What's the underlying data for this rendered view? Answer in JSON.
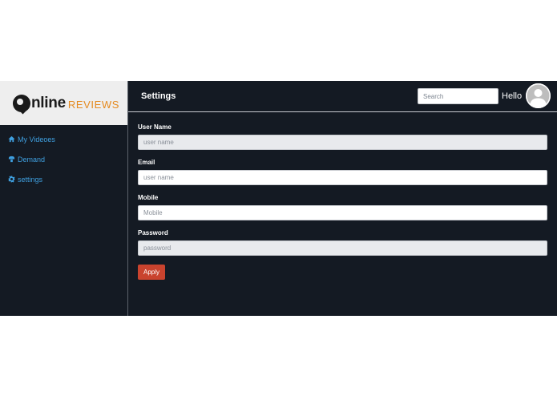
{
  "brand": {
    "logo_main": "nline",
    "logo_sub": "REVIEWS"
  },
  "sidebar": {
    "items": [
      {
        "label": "My Videoes",
        "icon": "home-icon"
      },
      {
        "label": "Demand",
        "icon": "demand-icon"
      },
      {
        "label": "settings",
        "icon": "gear-icon"
      }
    ]
  },
  "header": {
    "title": "Settings",
    "search_placeholder": "Search",
    "greeting": "Hello",
    "avatar_icon": "user-avatar-icon"
  },
  "form": {
    "fields": [
      {
        "label": "User Name",
        "placeholder": "user name",
        "value": "",
        "state": "disabled"
      },
      {
        "label": "Email",
        "placeholder": "user name",
        "value": "",
        "state": "enabled"
      },
      {
        "label": "Mobile",
        "placeholder": "Mobile",
        "value": "",
        "state": "enabled"
      },
      {
        "label": "Password",
        "placeholder": "password",
        "value": "",
        "state": "disabled"
      }
    ],
    "submit_label": "Apply"
  },
  "colors": {
    "background": "#141a23",
    "link": "#3fa0e0",
    "logo_accent": "#e58a1f",
    "button": "#c9432e",
    "disabled_input": "#e8eaed"
  }
}
